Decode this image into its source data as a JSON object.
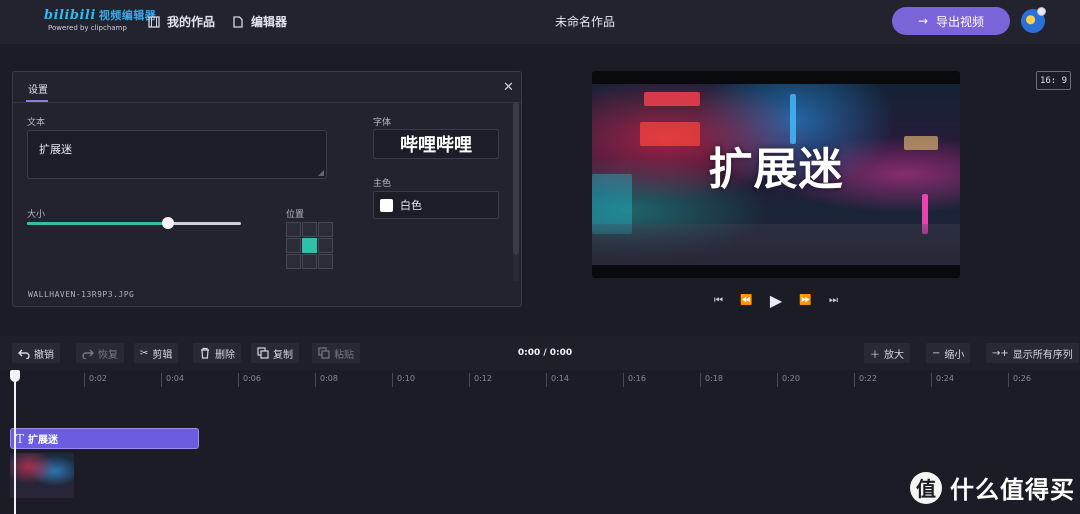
{
  "header": {
    "logo_brand": "bilibili",
    "logo_title": "视频编辑器",
    "logo_sub": "Powered by clipchamp",
    "nav_my_works": "我的作品",
    "nav_editor": "编辑器",
    "project_title": "未命名作品",
    "export_label": "导出视频"
  },
  "panel": {
    "tab": "设置",
    "text_label": "文本",
    "text_value": "扩展迷",
    "size_label": "大小",
    "size_value": 0.66,
    "position_label": "位置",
    "position_selected": "center",
    "font_label": "字体",
    "font_value": "哔哩哔哩",
    "color_label": "主色",
    "color_value": "白色",
    "color_hex": "#ffffff",
    "filename": "WALLHAVEN-13R9P3.JPG"
  },
  "preview": {
    "overlay_text": "扩展迷",
    "aspect": "16: 9"
  },
  "toolbar": {
    "undo": "撤销",
    "redo": "恢复",
    "cut": "剪辑",
    "delete": "删除",
    "copy": "复制",
    "paste": "粘贴",
    "timecode": "0:00 / 0:00",
    "zoom_in": "放大",
    "zoom_out": "缩小",
    "show_all": "显示所有序列"
  },
  "ruler": {
    "ticks": [
      "0:02",
      "0:04",
      "0:06",
      "0:08",
      "0:10",
      "0:12",
      "0:14",
      "0:16",
      "0:18",
      "0:20",
      "0:22",
      "0:24",
      "0:26"
    ]
  },
  "tracks": {
    "text_clip_label": "扩展迷"
  },
  "watermark": {
    "symbol": "值",
    "text": "什么值得买"
  },
  "colors": {
    "accent": "#7b63d8",
    "teal": "#2fc1a8",
    "background": "#1c1c26"
  }
}
